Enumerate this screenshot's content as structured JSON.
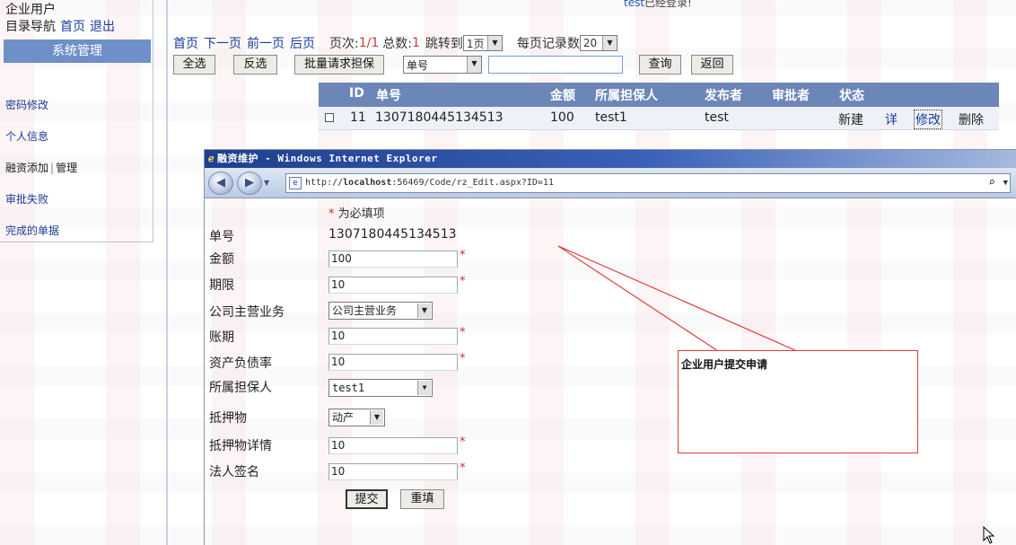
{
  "left_panel": {
    "user_type": "企业用户",
    "nav_prefix": "目录导航",
    "home_link": "首页",
    "logout_link": "退出",
    "section_header": "系统管理",
    "menu": [
      {
        "label": "密码修改"
      },
      {
        "label": "个人信息"
      },
      {
        "label_a": "融资添加",
        "sep": "|",
        "label_b": "管理"
      },
      {
        "label": "审批失败"
      },
      {
        "label": "完成的单据"
      }
    ]
  },
  "header": {
    "user": "test",
    "status_text": "已经登录!"
  },
  "pager": {
    "first": "首页",
    "next": "下一页",
    "prev": "前一页",
    "last": "后页",
    "page_label": "页次:",
    "page_value": "1/1",
    "total_label": "总数:",
    "total_value": "1",
    "jump_label": "跳转到",
    "jump_value": "1页",
    "per_page_label": "每页记录数",
    "per_page_value": "20"
  },
  "toolbar": {
    "select_all": "全选",
    "invert": "反选",
    "batch_request": "批量请求担保",
    "field_select": "单号",
    "search_value": "",
    "query": "查询",
    "back": "返回"
  },
  "table": {
    "headers": [
      "ID",
      "单号",
      "金额",
      "所属担保人",
      "发布者",
      "审批者",
      "状态"
    ],
    "rows": [
      {
        "id": "11",
        "order_no": "1307180445134513",
        "amount": "100",
        "guarantor": "test1",
        "publisher": "test",
        "approver": "",
        "status": "新建",
        "detail": "详",
        "edit": "修改",
        "delete": "删除"
      }
    ]
  },
  "popup": {
    "title": "融资维护 - Windows Internet Explorer",
    "url_prefix": "http://",
    "url_host": "localhost",
    "url_rest": ":56469/Code/rz_Edit.aspx?ID=11",
    "required_note": "为必填项",
    "required_mark": "*",
    "fields": {
      "order_no_label": "单号",
      "order_no_value": "1307180445134513",
      "amount_label": "金额",
      "amount_value": "100",
      "term_label": "期限",
      "term_value": "10",
      "main_business_label": "公司主营业务",
      "main_business_value": "公司主营业务",
      "account_period_label": "账期",
      "account_period_value": "10",
      "debt_ratio_label": "资产负债率",
      "debt_ratio_value": "10",
      "guarantor_label": "所属担保人",
      "guarantor_value": "test1",
      "collateral_label": "抵押物",
      "collateral_value": "动产",
      "collateral_detail_label": "抵押物详情",
      "collateral_detail_value": "10",
      "legal_sign_label": "法人签名",
      "legal_sign_value": "10"
    },
    "submit": "提交",
    "reset": "重填"
  },
  "annotation": {
    "text": "企业用户提交申请",
    "color": "#e03a3a"
  }
}
